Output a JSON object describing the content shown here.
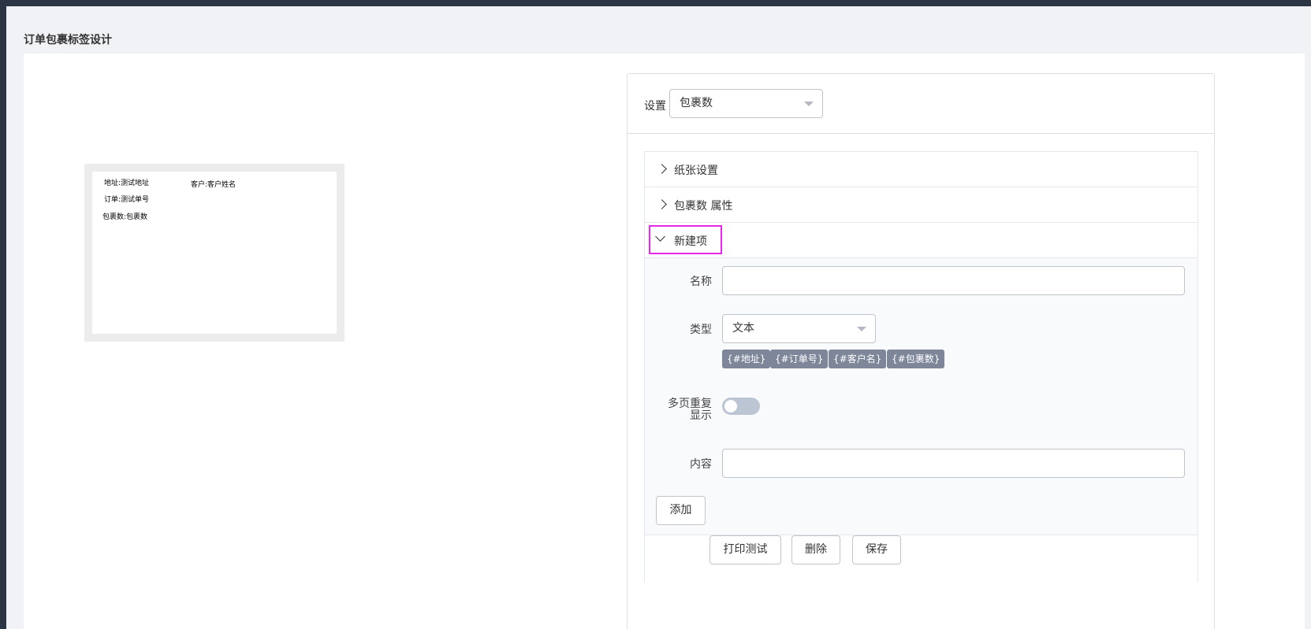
{
  "page": {
    "title": "订单包裹标签设计"
  },
  "preview": {
    "address": "地址:测试地址",
    "customer": "客户:客户姓名",
    "order": "订单:测试单号",
    "packages": "包裹数:包裹数"
  },
  "settings": {
    "label": "设置",
    "selected": "包裹数"
  },
  "collapse": {
    "items": [
      {
        "title": "纸张设置",
        "expanded": false
      },
      {
        "title": "包裹数 属性",
        "expanded": false
      },
      {
        "title": "新建项",
        "expanded": true
      }
    ]
  },
  "form": {
    "name_label": "名称",
    "name_value": "",
    "type_label": "类型",
    "type_value": "文本",
    "tags": [
      "{#地址}",
      "{#订单号}",
      "{#客户名}",
      "{#包裹数}"
    ],
    "repeat_label_line1": "多页重复",
    "repeat_label_line2": "显示",
    "repeat_on": false,
    "content_label": "内容",
    "content_value": "",
    "add_button": "添加"
  },
  "footer": {
    "print_test": "打印测试",
    "delete": "删除",
    "save": "保存"
  },
  "colors": {
    "highlight": "#e827e8",
    "tag_bg": "#7d8799",
    "switch_off": "#bcc5d3"
  }
}
